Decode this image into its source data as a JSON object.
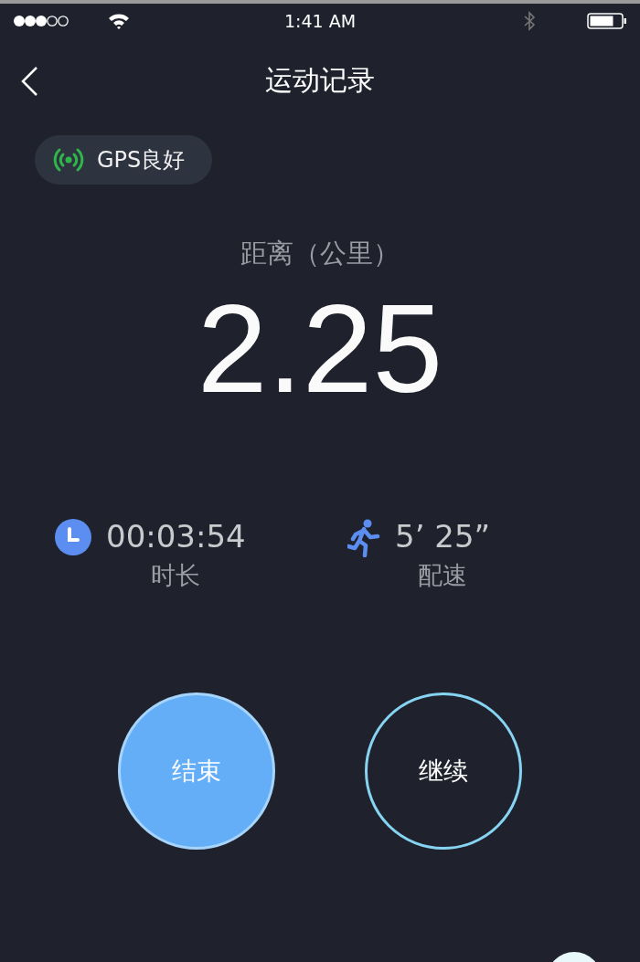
{
  "status_bar": {
    "time": "1:41 AM"
  },
  "nav": {
    "title": "运动记录"
  },
  "gps": {
    "label": "GPS良好"
  },
  "distance": {
    "label": "距离（公里）",
    "value": "2.25"
  },
  "stats": [
    {
      "kind": "clock",
      "value": "00:03:54",
      "label": "时长"
    },
    {
      "kind": "runner",
      "value": "5’ 25”",
      "label": "配速"
    }
  ],
  "actions": [
    {
      "label": "结束",
      "kind": "filled"
    },
    {
      "label": "继续",
      "kind": "outline"
    }
  ]
}
